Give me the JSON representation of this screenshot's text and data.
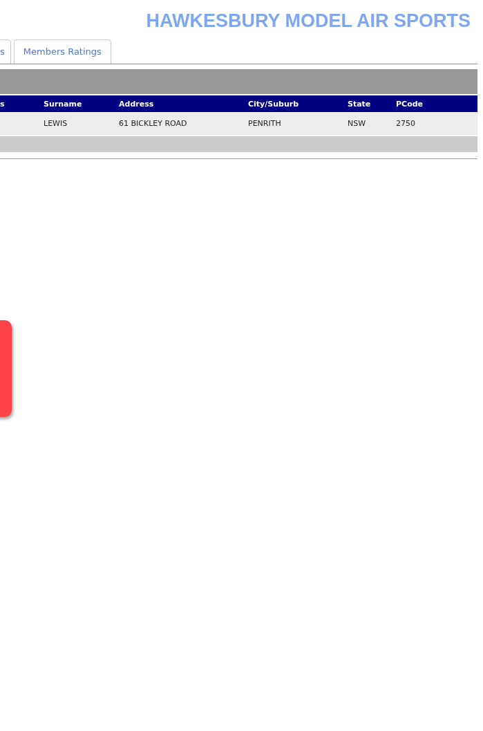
{
  "header": {
    "title": "HAWKESBURY MODEL AIR SPORTS"
  },
  "tabs": [
    {
      "label": "s",
      "selected": false
    },
    {
      "label": "Members Ratings",
      "selected": false
    }
  ],
  "table": {
    "columns": [
      "s",
      "Surname",
      "Address",
      "City/Suburb",
      "State",
      "PCode"
    ],
    "rows": [
      {
        "cells": [
          "",
          "LEWIS",
          "61 BICKLEY ROAD",
          "PENRITH",
          "NSW",
          "2750"
        ]
      }
    ]
  }
}
